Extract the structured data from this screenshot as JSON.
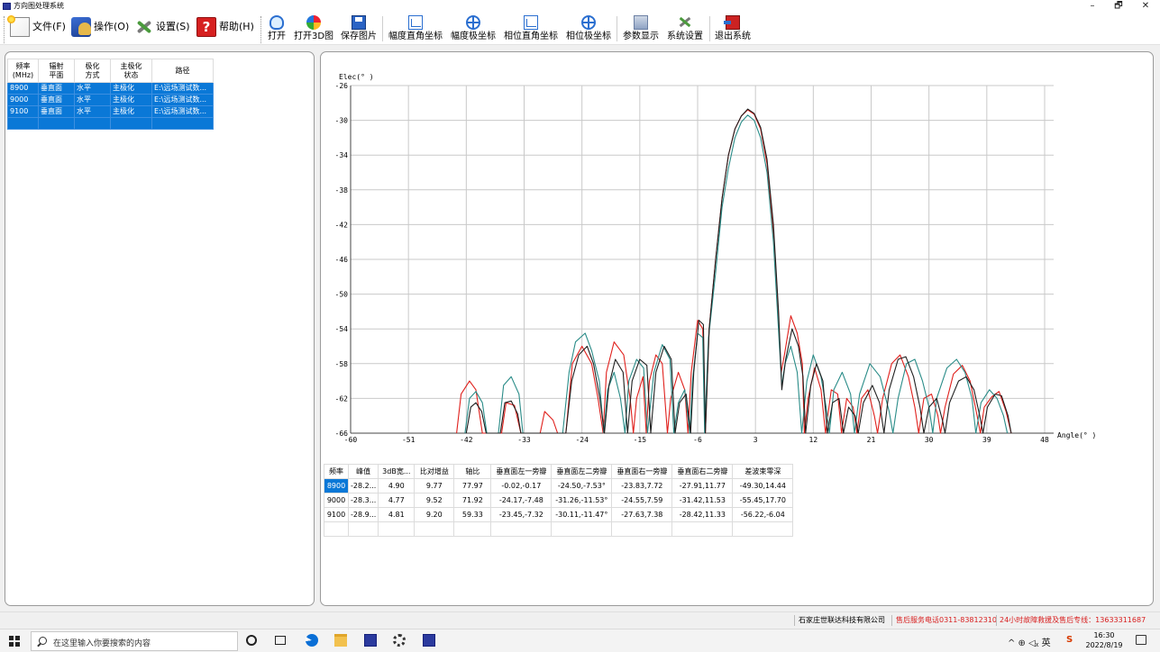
{
  "window": {
    "title": "方向图处理系统",
    "controls": {
      "minimize": "–",
      "maximize": "🗗",
      "close": "✕"
    }
  },
  "menu": [
    {
      "label": "文件(F)",
      "icon": "file-new-icon"
    },
    {
      "label": "操作(O)",
      "icon": "operation-icon"
    },
    {
      "label": "设置(S)",
      "icon": "tools-icon"
    },
    {
      "label": "帮助(H)",
      "icon": "help-icon",
      "glyph": "?"
    }
  ],
  "toolbar": [
    {
      "label": "打开",
      "icon": "open-icon"
    },
    {
      "label": "打开3D图",
      "icon": "3d-icon"
    },
    {
      "label": "保存图片",
      "icon": "save-icon"
    },
    {
      "label": "幅度直角坐标",
      "icon": "rect-coord-icon"
    },
    {
      "label": "幅度极坐标",
      "icon": "polar-coord-icon"
    },
    {
      "label": "相位直角坐标",
      "icon": "rect-coord-icon"
    },
    {
      "label": "相位极坐标",
      "icon": "polar-coord-icon"
    },
    {
      "label": "参数显示",
      "icon": "param-icon"
    },
    {
      "label": "系统设置",
      "icon": "settings-icon"
    },
    {
      "label": "退出系统",
      "icon": "exit-icon"
    }
  ],
  "file_list": {
    "headers": [
      "频率\n(MHz)",
      "辐射\n平面",
      "极化\n方式",
      "主极化\n状态",
      "路径"
    ],
    "rows": [
      [
        "8900",
        "垂直面",
        "水平",
        "主极化",
        "E:\\远场测试数..."
      ],
      [
        "9000",
        "垂直面",
        "水平",
        "主极化",
        "E:\\远场测试数..."
      ],
      [
        "9100",
        "垂直面",
        "水平",
        "主极化",
        "E:\\远场测试数..."
      ],
      [
        "",
        "",
        "",
        "",
        ""
      ]
    ]
  },
  "chart_data": {
    "type": "line",
    "ylabel": "Elec(° )",
    "xlabel": "Angle(° )",
    "xlim": [
      -60,
      48
    ],
    "ylim": [
      -66,
      -26
    ],
    "xticks": [
      -60,
      -51,
      -42,
      -33,
      -24,
      -15,
      -6,
      3,
      12,
      21,
      30,
      39,
      48
    ],
    "yticks": [
      -26,
      -30,
      -34,
      -38,
      -42,
      -46,
      -50,
      -54,
      -58,
      -62,
      -66
    ],
    "grid": true,
    "series": [
      {
        "color": "#e0201c",
        "points": [
          [
            -43.5,
            -66
          ],
          [
            -42.8,
            -61.5
          ],
          [
            -41.5,
            -60
          ],
          [
            -40.5,
            -61
          ],
          [
            -39.5,
            -66
          ],
          [
            -36.5,
            -66
          ],
          [
            -35.8,
            -62.5
          ],
          [
            -34.5,
            -62.8
          ],
          [
            -33.5,
            -66
          ],
          [
            -30.5,
            -66
          ],
          [
            -29.8,
            -63.5
          ],
          [
            -28.5,
            -64.5
          ],
          [
            -27.8,
            -66
          ],
          [
            -26.5,
            -66
          ],
          [
            -25.5,
            -58
          ],
          [
            -24,
            -56
          ],
          [
            -22.5,
            -58
          ],
          [
            -21.5,
            -62
          ],
          [
            -20.7,
            -66
          ],
          [
            -20.2,
            -59
          ],
          [
            -19,
            -55.5
          ],
          [
            -17.5,
            -57
          ],
          [
            -16.5,
            -62
          ],
          [
            -16,
            -66
          ],
          [
            -15.5,
            -62
          ],
          [
            -14.5,
            -59.5
          ],
          [
            -14,
            -66
          ],
          [
            -13.5,
            -60
          ],
          [
            -12.5,
            -57
          ],
          [
            -11.5,
            -58
          ],
          [
            -10.7,
            -66
          ],
          [
            -10.2,
            -62
          ],
          [
            -9,
            -59
          ],
          [
            -8,
            -61
          ],
          [
            -7.5,
            -66
          ],
          [
            -7,
            -59
          ],
          [
            -6,
            -53
          ],
          [
            -5.2,
            -54
          ],
          [
            -4.8,
            -66
          ],
          [
            -4.2,
            -54
          ],
          [
            -3.2,
            -46
          ],
          [
            -2.2,
            -39
          ],
          [
            -1.2,
            -34
          ],
          [
            -0.2,
            -31
          ],
          [
            0.8,
            -29.5
          ],
          [
            1.8,
            -28.8
          ],
          [
            2.8,
            -29.3
          ],
          [
            3.8,
            -31
          ],
          [
            4.8,
            -35
          ],
          [
            5.8,
            -43
          ],
          [
            6.6,
            -53
          ],
          [
            7,
            -59
          ],
          [
            7.5,
            -57
          ],
          [
            8.5,
            -52.5
          ],
          [
            9.5,
            -54.5
          ],
          [
            10.3,
            -58
          ],
          [
            10.6,
            -66
          ],
          [
            11.2,
            -62
          ],
          [
            12.2,
            -58.5
          ],
          [
            13.2,
            -61
          ],
          [
            13.9,
            -66
          ],
          [
            14.8,
            -61
          ],
          [
            15.8,
            -61.5
          ],
          [
            16.4,
            -66
          ],
          [
            17.2,
            -62
          ],
          [
            18.2,
            -63
          ],
          [
            18.8,
            -66
          ],
          [
            19.5,
            -62
          ],
          [
            20.5,
            -61
          ],
          [
            21.5,
            -64
          ],
          [
            22,
            -66
          ],
          [
            22.8,
            -62
          ],
          [
            24.2,
            -58
          ],
          [
            25.5,
            -57
          ],
          [
            26.8,
            -59.5
          ],
          [
            27.8,
            -63
          ],
          [
            28.4,
            -66
          ],
          [
            29.2,
            -62
          ],
          [
            30.4,
            -61.5
          ],
          [
            31.4,
            -64
          ],
          [
            31.8,
            -66
          ],
          [
            32.5,
            -63
          ],
          [
            33.8,
            -59.2
          ],
          [
            35.2,
            -58.2
          ],
          [
            36.4,
            -60
          ],
          [
            37.5,
            -64
          ],
          [
            38,
            -66
          ],
          [
            38.6,
            -63
          ],
          [
            39.8,
            -61.8
          ],
          [
            40.9,
            -61.2
          ],
          [
            42,
            -63.5
          ],
          [
            42.8,
            -66
          ]
        ]
      },
      {
        "color": "#2a8c88",
        "points": [
          [
            -42.2,
            -66
          ],
          [
            -41.5,
            -62
          ],
          [
            -40.5,
            -61.2
          ],
          [
            -39.5,
            -62.5
          ],
          [
            -38.8,
            -66
          ],
          [
            -37,
            -66
          ],
          [
            -36.2,
            -60.5
          ],
          [
            -35,
            -59.5
          ],
          [
            -33.8,
            -61.5
          ],
          [
            -33.2,
            -66
          ],
          [
            -27,
            -66
          ],
          [
            -26,
            -59
          ],
          [
            -25,
            -55.5
          ],
          [
            -23.5,
            -54.5
          ],
          [
            -22.5,
            -56.5
          ],
          [
            -21.3,
            -60
          ],
          [
            -20.6,
            -66
          ],
          [
            -20,
            -61
          ],
          [
            -19,
            -59
          ],
          [
            -18,
            -62
          ],
          [
            -17.3,
            -66
          ],
          [
            -16.7,
            -60
          ],
          [
            -15.5,
            -57.5
          ],
          [
            -14.4,
            -58.5
          ],
          [
            -13.8,
            -66
          ],
          [
            -12.8,
            -59
          ],
          [
            -11.5,
            -55.8
          ],
          [
            -10.3,
            -57.5
          ],
          [
            -9.7,
            -66
          ],
          [
            -9,
            -62.5
          ],
          [
            -8,
            -61
          ],
          [
            -7.2,
            -66
          ],
          [
            -6.8,
            -60
          ],
          [
            -6,
            -54.5
          ],
          [
            -5.2,
            -55
          ],
          [
            -4.9,
            -66
          ],
          [
            -4.3,
            -55
          ],
          [
            -3.2,
            -47.5
          ],
          [
            -2.2,
            -40
          ],
          [
            -1.2,
            -35.5
          ],
          [
            -0.2,
            -32
          ],
          [
            0.8,
            -30.2
          ],
          [
            1.8,
            -29.4
          ],
          [
            2.8,
            -30
          ],
          [
            3.8,
            -32
          ],
          [
            4.8,
            -36
          ],
          [
            5.8,
            -44
          ],
          [
            6.5,
            -53
          ],
          [
            7.1,
            -60.5
          ],
          [
            7.6,
            -58
          ],
          [
            8.5,
            -56
          ],
          [
            9.5,
            -59
          ],
          [
            10.2,
            -66
          ],
          [
            11,
            -60
          ],
          [
            12,
            -57
          ],
          [
            13.2,
            -59.5
          ],
          [
            14,
            -63
          ],
          [
            14.5,
            -66
          ],
          [
            15.2,
            -61
          ],
          [
            16.5,
            -59
          ],
          [
            17.8,
            -61.5
          ],
          [
            18.4,
            -66
          ],
          [
            19.2,
            -61.5
          ],
          [
            20.8,
            -58
          ],
          [
            22.4,
            -59.5
          ],
          [
            23.8,
            -63.5
          ],
          [
            24.4,
            -66
          ],
          [
            25.2,
            -62
          ],
          [
            26.5,
            -58
          ],
          [
            27.8,
            -57.5
          ],
          [
            29,
            -60
          ],
          [
            30,
            -63
          ],
          [
            30.6,
            -66
          ],
          [
            31.2,
            -62
          ],
          [
            32.8,
            -58.5
          ],
          [
            34.3,
            -57.5
          ],
          [
            35.6,
            -59
          ],
          [
            36.7,
            -62
          ],
          [
            37.3,
            -66
          ],
          [
            38.1,
            -62.5
          ],
          [
            39.4,
            -61
          ],
          [
            40.6,
            -62
          ],
          [
            41.6,
            -64
          ],
          [
            42.2,
            -66
          ]
        ]
      },
      {
        "color": "#202020",
        "points": [
          [
            -42,
            -66
          ],
          [
            -41.3,
            -63
          ],
          [
            -40.5,
            -62.5
          ],
          [
            -39.6,
            -63.5
          ],
          [
            -38.9,
            -66
          ],
          [
            -36.7,
            -66
          ],
          [
            -36,
            -62.5
          ],
          [
            -35,
            -62.3
          ],
          [
            -34,
            -63.8
          ],
          [
            -33.5,
            -66
          ],
          [
            -26.5,
            -66
          ],
          [
            -25.6,
            -60
          ],
          [
            -24.5,
            -57
          ],
          [
            -23.2,
            -56
          ],
          [
            -22.2,
            -58
          ],
          [
            -21.2,
            -62
          ],
          [
            -20.5,
            -66
          ],
          [
            -19.8,
            -60.5
          ],
          [
            -18.8,
            -57.5
          ],
          [
            -17.6,
            -59
          ],
          [
            -16.9,
            -66
          ],
          [
            -16.2,
            -60
          ],
          [
            -15,
            -57.5
          ],
          [
            -13.9,
            -58.2
          ],
          [
            -13.3,
            -66
          ],
          [
            -12.5,
            -59
          ],
          [
            -11.2,
            -56
          ],
          [
            -10.1,
            -57.5
          ],
          [
            -9.5,
            -66
          ],
          [
            -8.8,
            -62.5
          ],
          [
            -7.8,
            -61.5
          ],
          [
            -7.1,
            -66
          ],
          [
            -6.6,
            -59
          ],
          [
            -5.8,
            -53
          ],
          [
            -5.1,
            -53.5
          ],
          [
            -4.8,
            -66
          ],
          [
            -4.2,
            -54
          ],
          [
            -3.2,
            -46
          ],
          [
            -2.2,
            -39
          ],
          [
            -1.2,
            -34
          ],
          [
            -0.2,
            -31
          ],
          [
            0.8,
            -29.5
          ],
          [
            1.8,
            -28.7
          ],
          [
            2.8,
            -29.2
          ],
          [
            3.8,
            -30.8
          ],
          [
            4.8,
            -34.5
          ],
          [
            5.8,
            -42
          ],
          [
            6.6,
            -52
          ],
          [
            7.1,
            -61
          ],
          [
            7.7,
            -57.5
          ],
          [
            8.7,
            -54
          ],
          [
            9.7,
            -56
          ],
          [
            10.4,
            -59.5
          ],
          [
            10.8,
            -66
          ],
          [
            11.6,
            -60.5
          ],
          [
            12.5,
            -58
          ],
          [
            13.5,
            -60
          ],
          [
            14.2,
            -66
          ],
          [
            15,
            -62.5
          ],
          [
            16,
            -62
          ],
          [
            16.7,
            -66
          ],
          [
            17.5,
            -63
          ],
          [
            18.5,
            -64
          ],
          [
            19,
            -66
          ],
          [
            19.8,
            -62.5
          ],
          [
            21.2,
            -60.5
          ],
          [
            22.3,
            -62.5
          ],
          [
            23,
            -66
          ],
          [
            23.8,
            -61
          ],
          [
            25.2,
            -57.5
          ],
          [
            26.4,
            -57.2
          ],
          [
            27.6,
            -59.5
          ],
          [
            28.6,
            -63
          ],
          [
            29.2,
            -66
          ],
          [
            30,
            -63
          ],
          [
            31.2,
            -62
          ],
          [
            32.1,
            -64.5
          ],
          [
            32.5,
            -66
          ],
          [
            33.2,
            -62.5
          ],
          [
            34.6,
            -60
          ],
          [
            35.8,
            -59.5
          ],
          [
            37,
            -61
          ],
          [
            37.9,
            -64
          ],
          [
            38.4,
            -66
          ],
          [
            39.1,
            -63
          ],
          [
            40.3,
            -61.5
          ],
          [
            41.3,
            -61.7
          ],
          [
            42.3,
            -64
          ],
          [
            42.8,
            -66
          ]
        ]
      }
    ]
  },
  "result_table": {
    "headers": [
      "频率",
      "峰值",
      "3dB宽...",
      "比对增益",
      "轴比",
      "垂直面左一旁瓣",
      "垂直面左二旁瓣",
      "垂直面右一旁瓣",
      "垂直面右二旁瓣",
      "差波束零深"
    ],
    "rows": [
      [
        "8900",
        "-28.2...",
        "4.90",
        "9.77",
        "77.97",
        "-0.02,-0.17",
        "-24.50,-7.53°",
        "-23.83,7.72",
        "-27.91,11.77",
        "-49.30,14.44"
      ],
      [
        "9000",
        "-28.3...",
        "4.77",
        "9.52",
        "71.92",
        "-24.17,-7.48",
        "-31.26,-11.53°",
        "-24.55,7.59",
        "-31.42,11.53",
        "-55.45,17.70"
      ],
      [
        "9100",
        "-28.9...",
        "4.81",
        "9.20",
        "59.33",
        "-23.45,-7.32",
        "-30.11,-11.47°",
        "-27.63,7.38",
        "-28.42,11.33",
        "-56.22,-6.04"
      ],
      [
        "",
        "",
        "",
        "",
        "",
        "",
        "",
        "",
        "",
        ""
      ]
    ]
  },
  "status": {
    "company": "石家庄世联达科技有限公司",
    "service_phone": "售后服务电话0311-83812310",
    "hotline": "24小时故障救援及售后专线：13633311687"
  },
  "taskbar": {
    "search_placeholder": "在这里输入你要搜索的内容",
    "tray": "^ ⊕ ◁ᵪ 英",
    "time": "16:30",
    "date": "2022/8/19"
  }
}
